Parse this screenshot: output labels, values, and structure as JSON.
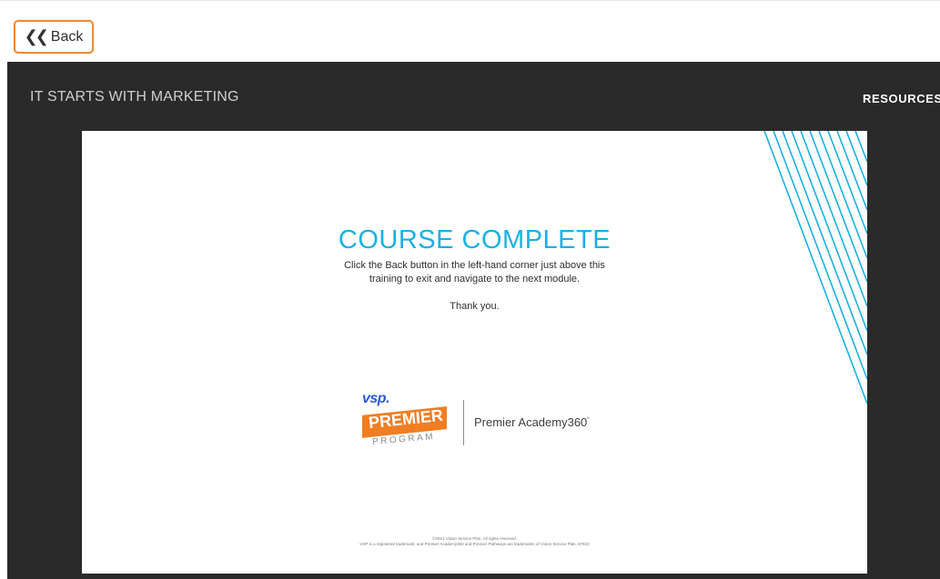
{
  "toolbar": {
    "back_label": "Back"
  },
  "player": {
    "course_title": "IT STARTS WITH MARKETING",
    "resources_label": "RESOURCES"
  },
  "slide": {
    "heading": "COURSE COMPLETE",
    "message_lines": [
      "Click the Back button in the left-hand corner just above this",
      "training to exit and navigate to the next module."
    ],
    "thanks": "Thank you.",
    "logo": {
      "vsp": "vsp.",
      "premier": "PREMIER",
      "program": "PROGRAM",
      "academy": "Premier Academy360",
      "academy_mark": "°"
    },
    "copyright_lines": [
      "©2021 Vision Service Plan. All rights reserved.",
      "VSP is a registered trademark, and Premier Academy360 and Premier Pathways are trademarks of Vision Service Plan. 87622"
    ]
  },
  "colors": {
    "accent_blue": "#1ab0e6",
    "back_border": "#f08a33",
    "player_bg": "#2a2a2a",
    "premier_orange": "#f07e22",
    "vsp_blue": "#2a5bd7"
  }
}
